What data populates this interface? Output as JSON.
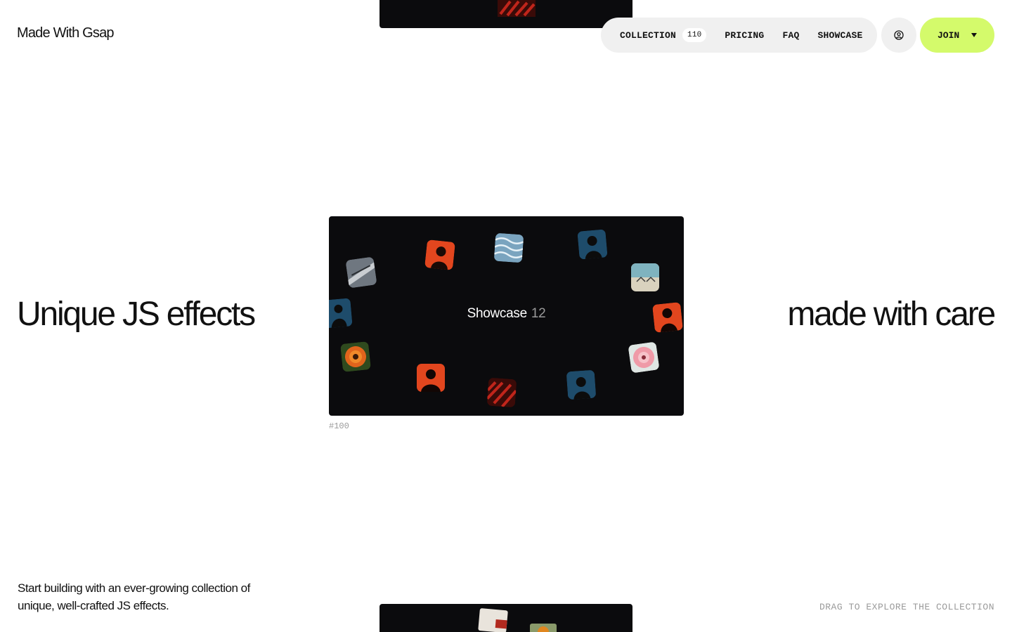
{
  "header": {
    "logo": "Made With Gsap",
    "nav": {
      "collection_label": "COLLECTION",
      "collection_count": "110",
      "pricing_label": "PRICING",
      "faq_label": "FAQ",
      "showcase_label": "SHOWCASE"
    },
    "account_icon": "user-circle-icon",
    "join_label": "JOIN",
    "join_icon": "caret-down-icon"
  },
  "hero": {
    "left_text": "Unique JS effects",
    "right_text": "made with care"
  },
  "card": {
    "title": "Showcase",
    "count": "12",
    "id": "#100"
  },
  "footer": {
    "tagline": "Start building with an ever-growing collection of unique, well-crafted JS effects.",
    "drag_hint": "DRAG TO EXPLORE THE COLLECTION"
  },
  "colors": {
    "accent": "#d4fa6b",
    "card_bg": "#0b0b0d",
    "pill_bg": "#f0f0f0",
    "muted_text": "#9a9a9a",
    "thumb_orange": "#e2461e",
    "thumb_blue": "#1e4c6b"
  }
}
